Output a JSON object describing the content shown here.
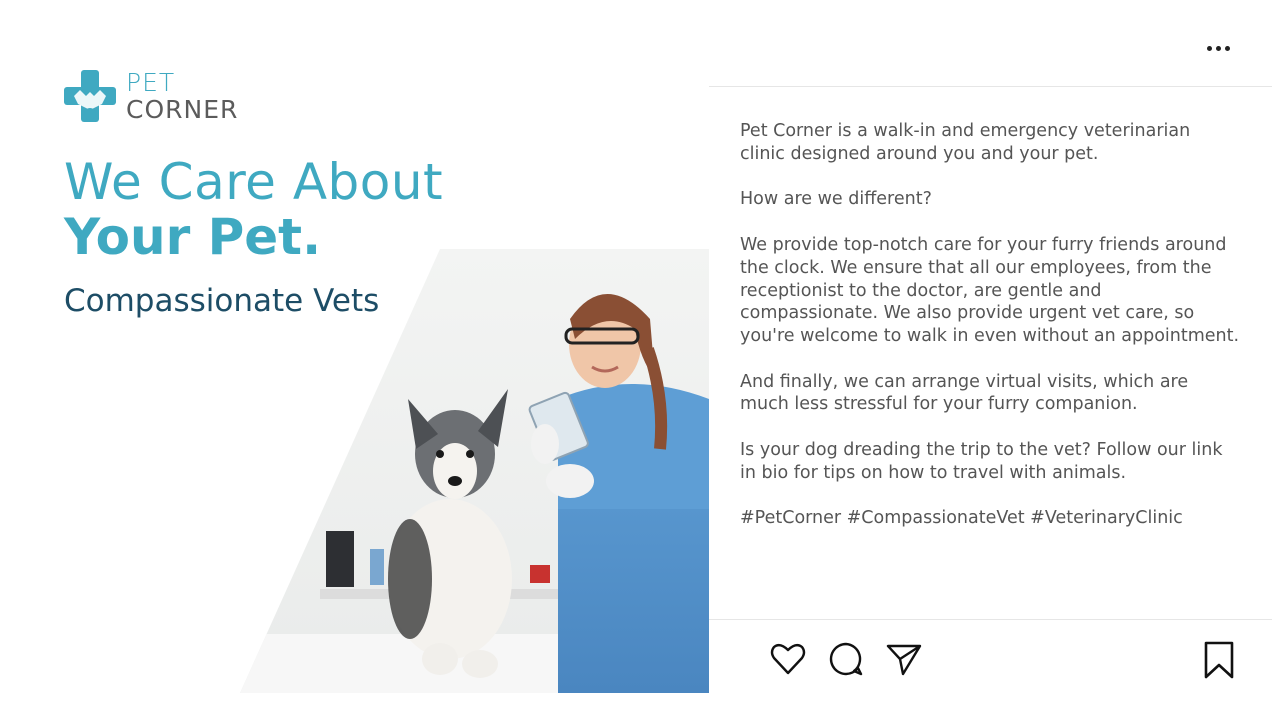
{
  "brand": {
    "line1": "PET",
    "line2": "CORNER",
    "accent_color": "#3fa9c1",
    "text_color": "#5b5b5b"
  },
  "hero": {
    "headline_line1": "We Care About",
    "headline_line2": "Your Pet.",
    "subheadline": "Compassionate Vets",
    "subheadline_color": "#1d4d66",
    "photo": "veterinarian-with-dog-photo"
  },
  "post": {
    "menu_icon": "more-horizontal-icon",
    "caption": [
      "Pet Corner is a walk-in and emergency veterinarian clinic designed around you and your pet.",
      "How are we different?",
      "We provide top-notch care for your furry friends around the clock. We ensure that all our employees, from the receptionist to the doctor, are gentle and compassionate. We also provide urgent vet care, so you're welcome to walk in even without an appointment.",
      "And finally, we can arrange virtual visits, which are much less stressful for your furry companion.",
      "Is your dog dreading the trip to the vet? Follow our link in bio for tips on how to travel with animals.",
      "#PetCorner #CompassionateVet #VeterinaryClinic"
    ],
    "actions": {
      "like_icon": "heart-icon",
      "comment_icon": "comment-icon",
      "share_icon": "send-icon",
      "save_icon": "bookmark-icon"
    }
  }
}
